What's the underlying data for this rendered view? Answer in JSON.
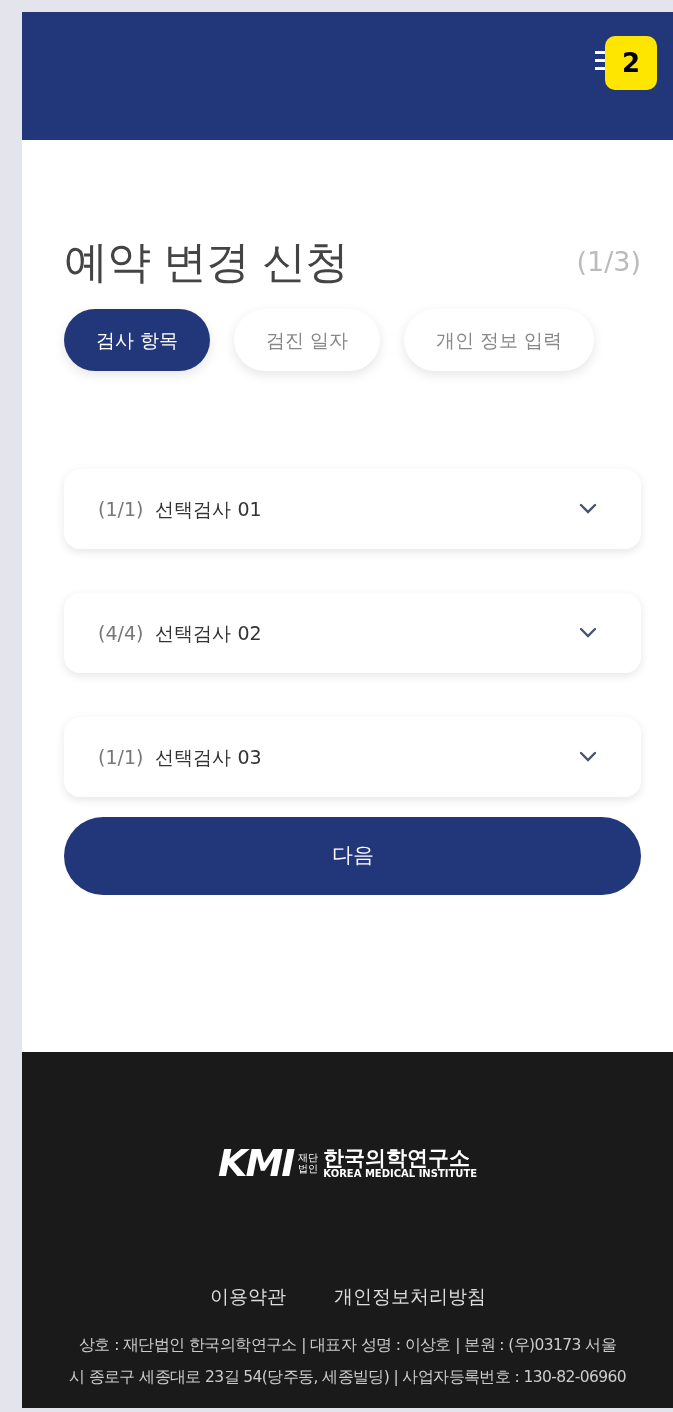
{
  "header": {
    "menu_badge": "2"
  },
  "title": "예약 변경 신청",
  "step": "(1/3)",
  "tabs": [
    {
      "label": "검사 항목",
      "selected": true
    },
    {
      "label": "검진 일자",
      "selected": false
    },
    {
      "label": "개인 정보 입력",
      "selected": false
    }
  ],
  "sections": [
    {
      "count": "(1/1)",
      "label": "선택검사 01",
      "expanded": false
    },
    {
      "count": "(4/4)",
      "label": "선택검사 02",
      "expanded": false
    },
    {
      "count": "(1/1)",
      "label": "선택검사 03",
      "expanded": false
    }
  ],
  "next_button": "다음",
  "footer": {
    "logo": {
      "mark": "KMI",
      "prefix": "재단법인",
      "name": "한국의학연구소",
      "english": "KOREA MEDICAL INSTITUTE"
    },
    "links": [
      "이용약관",
      "개인정보처리방침"
    ],
    "info": "상호 : 재단법인 한국의학연구소  |  대표자 성명 : 이상호  |  본원 : (우)03173 서울\n시 종로구 세종대로 23길 54(당주동, 세종빌딩)  |  사업자등록번호 : 130-82-06960"
  }
}
